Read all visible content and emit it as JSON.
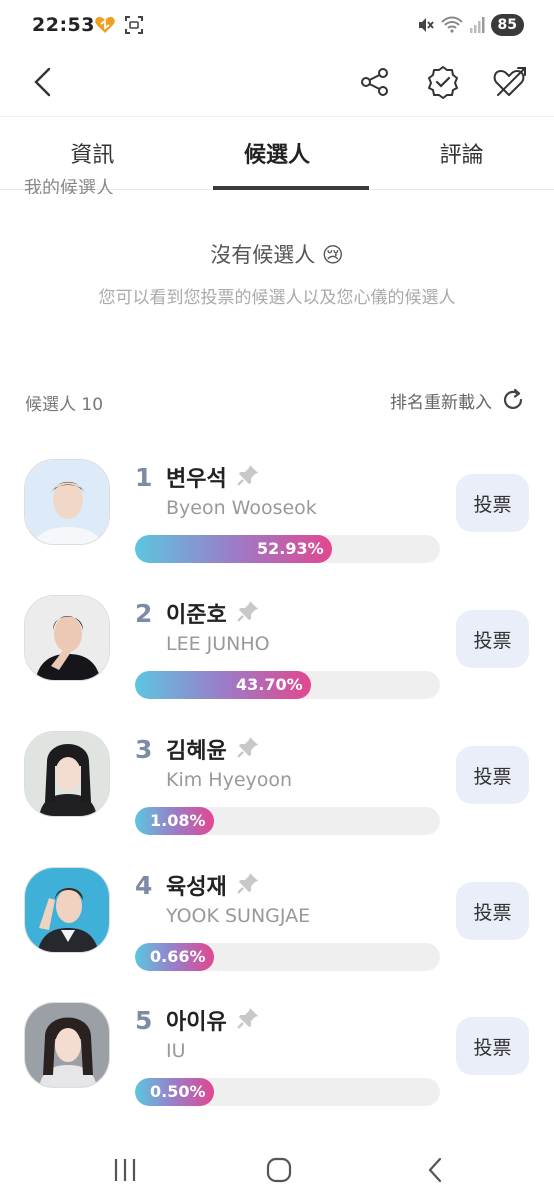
{
  "status": {
    "time": "22:53",
    "battery": "85"
  },
  "tabs": [
    {
      "label": "資訊",
      "active": false
    },
    {
      "label": "候選人",
      "active": true
    },
    {
      "label": "評論",
      "active": false
    }
  ],
  "my_candidates_label": "我的候選人",
  "empty_state": {
    "title": "沒有候選人 😢",
    "subtitle": "您可以看到您投票的候選人以及您心儀的候選人"
  },
  "candidates_header": {
    "count_label": "候選人 10",
    "reload_label": "排名重新載入"
  },
  "candidates": [
    {
      "rank": "1",
      "name": "변우석",
      "english_name": "Byeon Wooseok",
      "percent": "52.93%",
      "fraction": 0.645,
      "vote_label": "投票"
    },
    {
      "rank": "2",
      "name": "이준호",
      "english_name": "LEE JUNHO",
      "percent": "43.70%",
      "fraction": 0.578,
      "vote_label": "投票"
    },
    {
      "rank": "3",
      "name": "김혜윤",
      "english_name": "Kim Hyeyoon",
      "percent": "1.08%",
      "fraction": 0.26,
      "vote_label": "投票"
    },
    {
      "rank": "4",
      "name": "육성재",
      "english_name": "YOOK SUNGJAE",
      "percent": "0.66%",
      "fraction": 0.26,
      "vote_label": "投票"
    },
    {
      "rank": "5",
      "name": "아이유",
      "english_name": "IU",
      "percent": "0.50%",
      "fraction": 0.26,
      "vote_label": "投票"
    }
  ],
  "colors": {
    "accent_start": "#5cc6df",
    "accent_end": "#e2478f",
    "vote_bg": "#e9eef9",
    "rank": "#7d8ba6"
  }
}
